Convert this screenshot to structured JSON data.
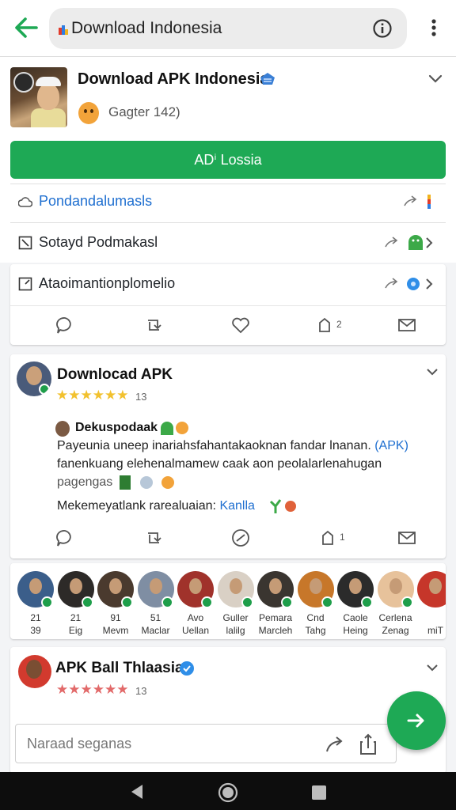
{
  "topbar": {
    "url_text": "Download Indonesia",
    "back_icon": "arrow-left-icon",
    "info_icon": "info-icon",
    "more_icon": "more-vert-icon",
    "accent": "#1ea955"
  },
  "app": {
    "title": "Download APK Indonesia",
    "subtitle": "Gagter 142)",
    "install_label": "ADⁱ Lossia"
  },
  "rows": [
    {
      "label": "Pondandalumasls",
      "color": "#1f6fd0"
    },
    {
      "label": "Sotayd Podmakasl",
      "color": "#222222"
    },
    {
      "label": "Ataoimantionplomelio",
      "color": "#222222"
    }
  ],
  "post1": {
    "title": "Downlocad APK",
    "stars": "★★★★★★",
    "star_count": "13",
    "author": "Dekuspodaak",
    "line1": "Payeunia uneep inariahsfahantakaoknan fandar lnanan.",
    "line1_link": "(APK)",
    "line2": "fanenkuang elehenalmamew caak aon peolalarlenahugan",
    "line3": "pagengas",
    "line4": "Mekemeyatlank rarealuaian:",
    "line4_link": "Kanlla",
    "action_share_count": "2",
    "action_share_count2": "1"
  },
  "people": [
    {
      "line1": "21",
      "line2": "39",
      "color": "#3b5e8a"
    },
    {
      "line1": "21",
      "line2": "Eig",
      "color": "#2d2a28"
    },
    {
      "line1": "91",
      "line2": "Mevm",
      "color": "#4a3a2e"
    },
    {
      "line1": "51",
      "line2": "Maclar",
      "color": "#7f8ea3"
    },
    {
      "line1": "Avo",
      "line2": "Uellan",
      "color": "#a0322b"
    },
    {
      "line1": "Guller",
      "line2": "lalilg",
      "color": "#d9d0c5"
    },
    {
      "line1": "Pemara",
      "line2": "Marcleh",
      "color": "#3a3530"
    },
    {
      "line1": "Cnd",
      "line2": "Tahg",
      "color": "#c7772a"
    },
    {
      "line1": "Caole",
      "line2": "Heing",
      "color": "#2b2b2b"
    },
    {
      "line1": "Cerlena",
      "line2": "Zenag",
      "color": "#e7c29b"
    },
    {
      "line1": "",
      "line2": "miT",
      "color": "#c6362a"
    }
  ],
  "post2": {
    "title": "APK Ball Thlaasia",
    "stars": "★★★★★★",
    "star_count": "13"
  },
  "composer": {
    "placeholder": "Naraad seganas",
    "fab_icon": "arrow-right-icon"
  },
  "system_nav": {
    "back": "nav-back-icon",
    "home": "nav-home-icon",
    "recents": "nav-recents-icon"
  }
}
